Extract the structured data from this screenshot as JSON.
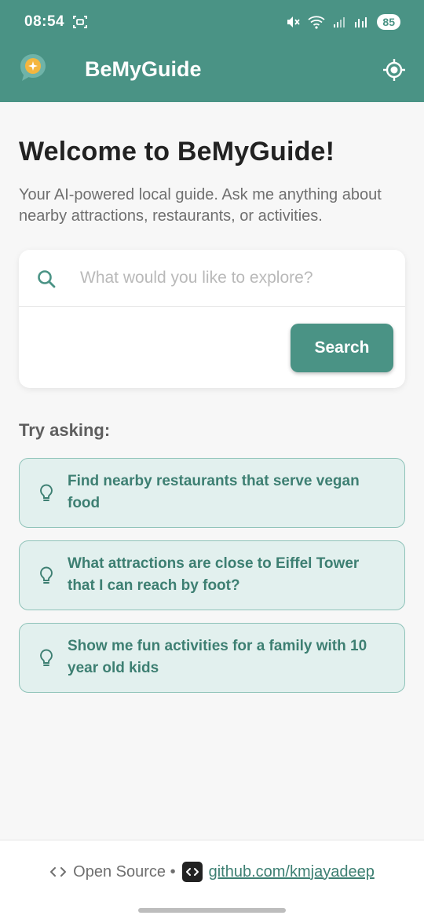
{
  "status_bar": {
    "time": "08:54",
    "battery": "85"
  },
  "app_bar": {
    "title": "BeMyGuide",
    "icons": [
      "app-logo-icon",
      "locate-icon"
    ]
  },
  "main": {
    "welcome_title": "Welcome to BeMyGuide!",
    "subtitle": "Your AI-powered local guide. Ask me anything about nearby attractions, restaurants, or activities.",
    "search": {
      "placeholder": "What would you like to explore?",
      "value": "",
      "button_label": "Search"
    },
    "try_label": "Try asking:",
    "suggestions": [
      {
        "text": "Find nearby restaurants that serve vegan food"
      },
      {
        "text": "What attractions are close to Eiffel Tower that I can reach by foot?"
      },
      {
        "text": "Show me fun activities for a family with 10 year old kids"
      }
    ]
  },
  "footer": {
    "open_source_label": "Open Source •",
    "github_link": "github.com/kmjayadeep"
  },
  "colors": {
    "primary": "#4a9385",
    "suggestion_bg": "#e2f0ee",
    "suggestion_text": "#3d7f72",
    "accent_yellow": "#f4b63f"
  }
}
